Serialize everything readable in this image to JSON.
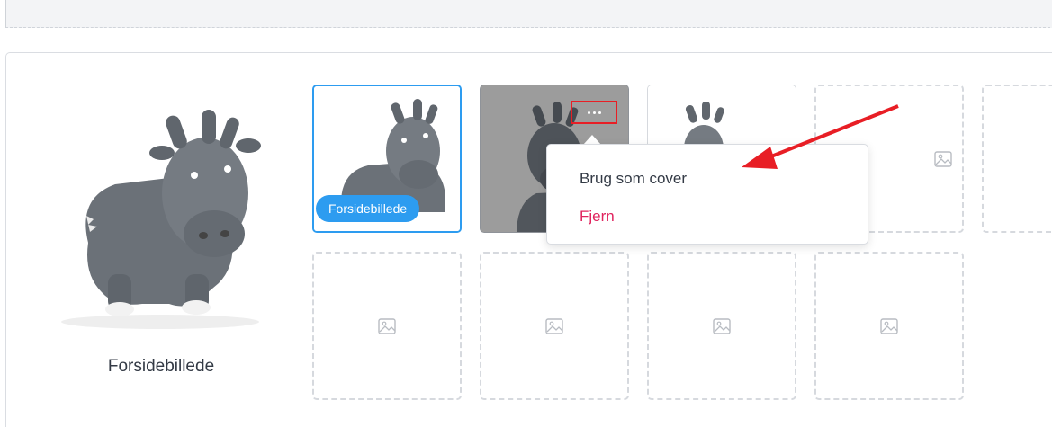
{
  "main_image": {
    "caption": "Forsidebillede"
  },
  "tiles": {
    "cover_badge": "Forsidebillede",
    "more_button": "⋯"
  },
  "context_menu": {
    "use_as_cover": "Brug som cover",
    "remove": "Fjern"
  },
  "colors": {
    "accent": "#2d9cf0",
    "danger": "#e0245e",
    "highlight_box": "#e81e25",
    "arrow": "#e81e25"
  }
}
